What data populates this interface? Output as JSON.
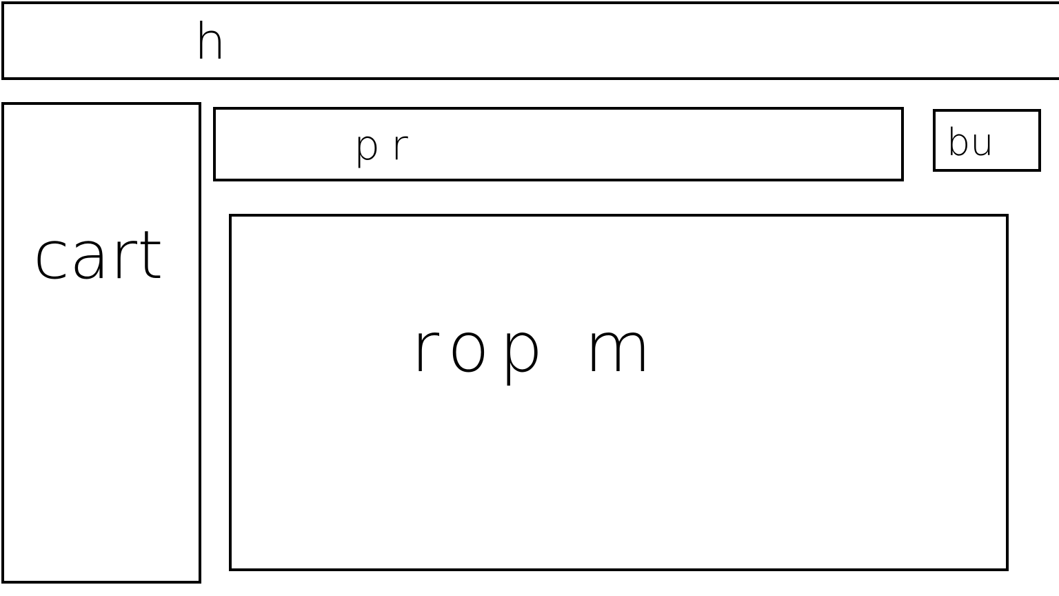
{
  "header": {
    "label": "h"
  },
  "cart": {
    "label": "cart"
  },
  "product_bar": {
    "label": "pr"
  },
  "buy_button": {
    "label": "bu"
  },
  "main": {
    "label": "rop m"
  },
  "colors": {
    "stroke": "#000000",
    "background": "#ffffff"
  }
}
